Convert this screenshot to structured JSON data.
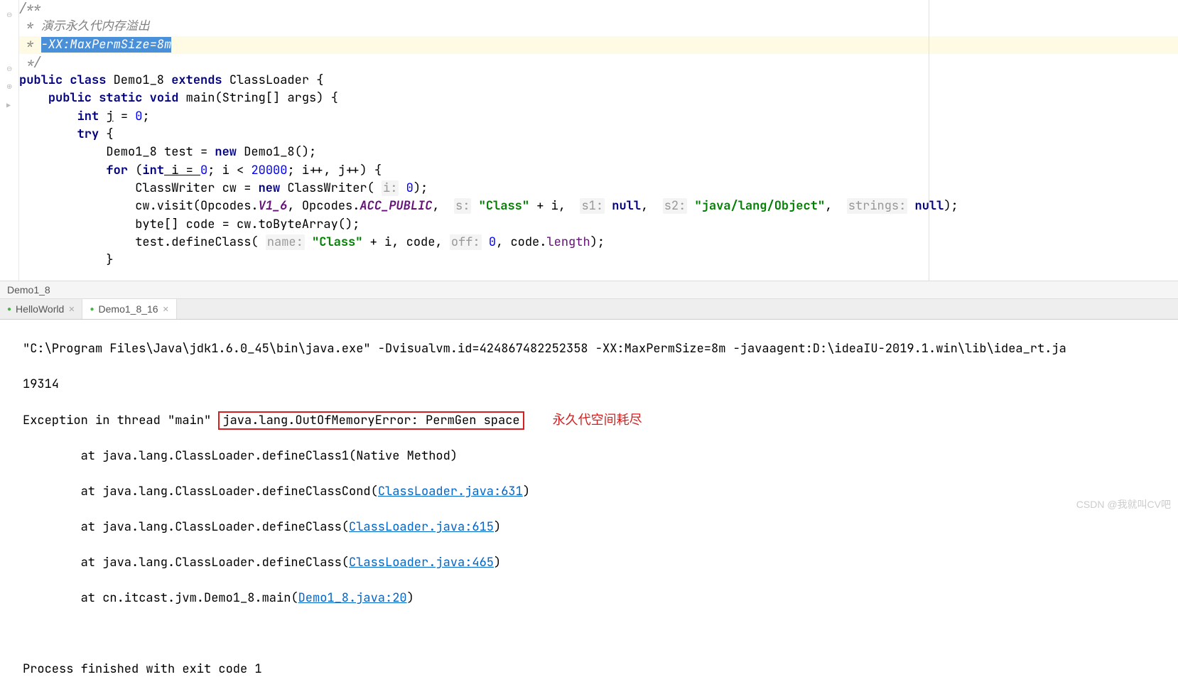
{
  "code": {
    "comment_open": "/**",
    "comment_line1": " * 演示永久代内存溢出",
    "comment_line2_prefix": " * ",
    "comment_line2_selected": "-XX:MaxPermSize=8m",
    "comment_close": " */",
    "class_decl": {
      "kw1": "public",
      "kw2": "class",
      "name": "Demo1_8",
      "kw3": "extends",
      "parent": "ClassLoader",
      "brace": "{"
    },
    "main_decl": {
      "kw1": "public",
      "kw2": "static",
      "kw3": "void",
      "name": "main",
      "params": "(String[] args) {"
    },
    "l_int": {
      "kw": "int",
      "var": "j",
      "eq": " = ",
      "val": "0",
      "semi": ";"
    },
    "l_try": {
      "kw": "try",
      "brace": " {"
    },
    "l_test": {
      "pre": "Demo1_8 test = ",
      "kw": "new",
      "post": " Demo1_8();"
    },
    "l_for": {
      "kw1": "for",
      "open": " (",
      "kw2": "int",
      "var": " i = ",
      "v0": "0",
      "mid": "; i < ",
      "v1": "20000",
      "post": "; i++, j++) {"
    },
    "l_cw": {
      "pre": "ClassWriter cw = ",
      "kw": "new",
      "post": " ClassWriter( ",
      "hint": "i:",
      "sp": " ",
      "v": "0",
      "end": ");"
    },
    "l_visit": {
      "pre": "cw.visit(Opcodes.",
      "v16": "V1_6",
      "mid1": ", Opcodes.",
      "acc": "ACC_PUBLIC",
      "mid2": ", ",
      "h1": "s:",
      "sp1": " ",
      "s1": "\"Class\"",
      "plus": " + i, ",
      "h2": "s1:",
      "sp2": " ",
      "n1": "null",
      "c1": ", ",
      "h3": "s2:",
      "sp3": " ",
      "s2": "\"java/lang/Object\"",
      "c2": ", ",
      "h4": "strings:",
      "sp4": " ",
      "n2": "null",
      "end": ");"
    },
    "l_byte": "byte[] code = cw.toByteArray();",
    "l_define": {
      "pre": "test.defineClass( ",
      "h1": "name:",
      "sp1": " ",
      "s1": "\"Class\"",
      "mid": " + i, code, ",
      "h2": "off:",
      "sp2": " ",
      "v": "0",
      "post": ", code.",
      "len": "length",
      "end": ");"
    },
    "l_close": "}"
  },
  "breadcrumb": "Demo1_8",
  "tabs": [
    {
      "label": "HelloWorld",
      "active": false
    },
    {
      "label": "Demo1_8_16",
      "active": true
    }
  ],
  "console": {
    "line1": "\"C:\\Program Files\\Java\\jdk1.6.0_45\\bin\\java.exe\" -Dvisualvm.id=424867482252358 -XX:MaxPermSize=8m -javaagent:D:\\ideaIU-2019.1.win\\lib\\idea_rt.ja",
    "line2": "19314",
    "ex_prefix": "Exception in thread \"main\" ",
    "ex_boxed": "java.lang.OutOfMemoryError: PermGen space",
    "annotation": "永久代空间耗尽",
    "st1": "        at java.lang.ClassLoader.defineClass1(Native Method)",
    "st2_pre": "        at java.lang.ClassLoader.defineClassCond(",
    "st2_link": "ClassLoader.java:631",
    "st2_post": ")",
    "st3_pre": "        at java.lang.ClassLoader.defineClass(",
    "st3_link": "ClassLoader.java:615",
    "st3_post": ")",
    "st4_pre": "        at java.lang.ClassLoader.defineClass(",
    "st4_link": "ClassLoader.java:465",
    "st4_post": ")",
    "st5_pre": "        at cn.itcast.jvm.Demo1_8.main(",
    "st5_link": "Demo1_8.java:20",
    "st5_post": ")",
    "finish": "Process finished with exit code 1"
  },
  "watermark": "CSDN @我就叫CV吧"
}
